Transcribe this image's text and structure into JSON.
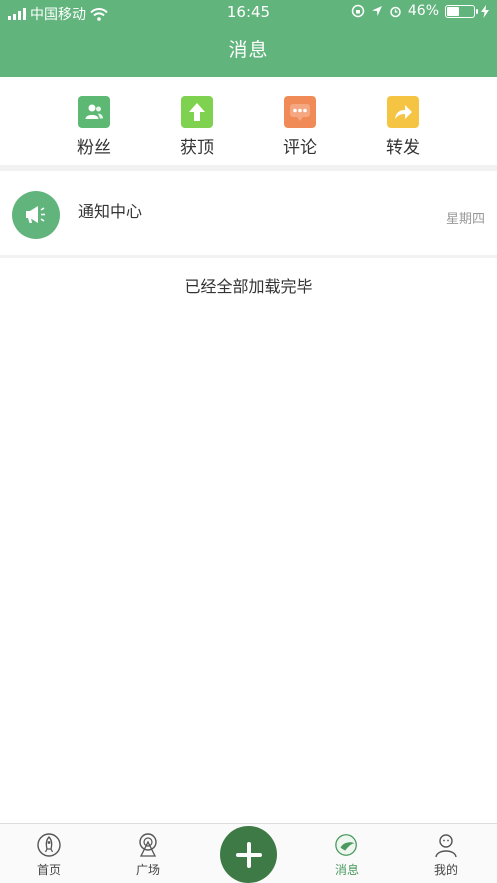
{
  "status_bar": {
    "carrier": "中国移动",
    "time": "16:45",
    "battery": "46%",
    "battery_level": 0.46
  },
  "header": {
    "title": "消息"
  },
  "quick_actions": [
    {
      "label": "粉丝",
      "icon": "fans-icon",
      "color": "#5cb873"
    },
    {
      "label": "获顶",
      "icon": "upvote-arrow-icon",
      "color": "#7ed24f"
    },
    {
      "label": "评论",
      "icon": "comment-bubble-icon",
      "color": "#f08a56"
    },
    {
      "label": "转发",
      "icon": "share-arrow-icon",
      "color": "#f6c443"
    }
  ],
  "messages": [
    {
      "title": "通知中心",
      "date": "星期四",
      "icon": "megaphone-icon"
    }
  ],
  "list_footer": "已经全部加载完毕",
  "tab_bar": {
    "items": [
      {
        "label": "首页",
        "icon": "rocket-icon"
      },
      {
        "label": "广场",
        "icon": "ferris-wheel-icon"
      },
      {
        "label": "",
        "icon": "plus-icon"
      },
      {
        "label": "消息",
        "icon": "message-icon",
        "active": true
      },
      {
        "label": "我的",
        "icon": "person-icon"
      }
    ]
  },
  "colors": {
    "primary": "#62b47d",
    "active_tab": "#4a9a5e",
    "plus_button": "#3e7a45"
  }
}
